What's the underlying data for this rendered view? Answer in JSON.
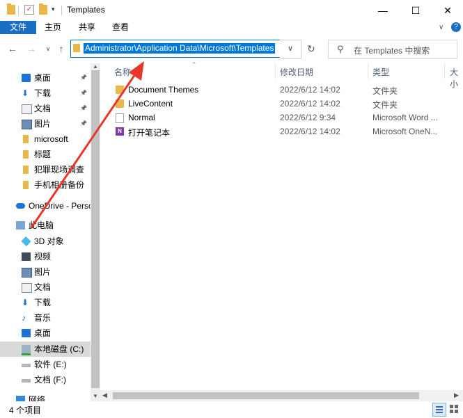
{
  "window": {
    "title": "Templates",
    "minimize_glyph": "—",
    "maximize_glyph": "☐",
    "close_glyph": "✕"
  },
  "ribbon": {
    "tabs": [
      "文件",
      "主页",
      "共享",
      "查看"
    ]
  },
  "address": {
    "path": "Administrator\\Application Data\\Microsoft\\Templates"
  },
  "search": {
    "placeholder": "在 Templates 中搜索"
  },
  "nav": {
    "items": [
      {
        "label": "桌面",
        "icon": "desktop-icon",
        "pinned": true
      },
      {
        "label": "下载",
        "icon": "download-icon",
        "pinned": true
      },
      {
        "label": "文档",
        "icon": "documents-icon",
        "pinned": true
      },
      {
        "label": "图片",
        "icon": "pictures-icon",
        "pinned": true
      },
      {
        "label": "microsoft",
        "icon": "folder-icon",
        "pinned": false
      },
      {
        "label": "标题",
        "icon": "folder-icon",
        "pinned": false
      },
      {
        "label": "犯罪现场调查",
        "icon": "folder-icon",
        "pinned": false
      },
      {
        "label": "手机相册备份",
        "icon": "folder-icon",
        "pinned": false
      },
      {
        "label": "OneDrive - Perso",
        "icon": "onedrive-icon",
        "pinned": false
      },
      {
        "label": "此电脑",
        "icon": "computer-icon",
        "pinned": false
      },
      {
        "label": "3D 对象",
        "icon": "3d-objects-icon",
        "pinned": false
      },
      {
        "label": "视频",
        "icon": "video-icon",
        "pinned": false
      },
      {
        "label": "图片",
        "icon": "pictures-icon",
        "pinned": false
      },
      {
        "label": "文档",
        "icon": "documents-icon",
        "pinned": false
      },
      {
        "label": "下载",
        "icon": "download-icon",
        "pinned": false
      },
      {
        "label": "音乐",
        "icon": "music-icon",
        "pinned": false
      },
      {
        "label": "桌面",
        "icon": "desktop-icon",
        "pinned": false
      },
      {
        "label": "本地磁盘 (C:)",
        "icon": "drive-c-icon",
        "pinned": false,
        "selected": true
      },
      {
        "label": "软件 (E:)",
        "icon": "drive-icon",
        "pinned": false
      },
      {
        "label": "文档 (F:)",
        "icon": "drive-icon",
        "pinned": false
      },
      {
        "label": "网络",
        "icon": "network-icon",
        "pinned": false
      }
    ]
  },
  "columns": {
    "name": "名称",
    "date": "修改日期",
    "type": "类型",
    "size": "大小"
  },
  "files": [
    {
      "name": "Document Themes",
      "date": "2022/6/12 14:02",
      "type": "文件夹",
      "icon": "folder-icon"
    },
    {
      "name": "LiveContent",
      "date": "2022/6/12 14:02",
      "type": "文件夹",
      "icon": "folder-icon"
    },
    {
      "name": "Normal",
      "date": "2022/6/12 9:34",
      "type": "Microsoft Word ...",
      "icon": "word-template-icon"
    },
    {
      "name": "打开笔记本",
      "date": "2022/6/12 14:02",
      "type": "Microsoft OneN...",
      "icon": "onenote-icon"
    }
  ],
  "status": {
    "item_count": "4 个项目"
  },
  "colors": {
    "accent": "#0078d7",
    "file_tab": "#1a6fc4",
    "folder": "#e8b84a",
    "arrow": "#e8362b"
  }
}
